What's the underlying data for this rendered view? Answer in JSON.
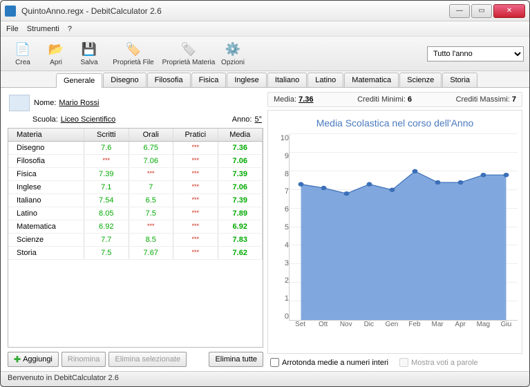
{
  "window": {
    "title": "QuintoAnno.regx - DebitCalculator 2.6"
  },
  "menu": {
    "file": "File",
    "strumenti": "Strumenti",
    "help": "?"
  },
  "toolbar": {
    "crea": "Crea",
    "apri": "Apri",
    "salva": "Salva",
    "prop_file": "Proprietà File",
    "prop_materia": "Proprietà Materia",
    "opzioni": "Opzioni"
  },
  "period": {
    "selected": "Tutto l'anno"
  },
  "tabs": [
    "Generale",
    "Disegno",
    "Filosofia",
    "Fisica",
    "Inglese",
    "Italiano",
    "Latino",
    "Matematica",
    "Scienze",
    "Storia"
  ],
  "student": {
    "nome_label": "Nome:",
    "nome": "Mario Rossi",
    "scuola_label": "Scuola:",
    "scuola": "Liceo Scientifico",
    "anno_label": "Anno:",
    "anno": "5°"
  },
  "grid": {
    "headers": {
      "materia": "Materia",
      "scritti": "Scritti",
      "orali": "Orali",
      "pratici": "Pratici",
      "media": "Media"
    },
    "rows": [
      {
        "materia": "Disegno",
        "scritti": "7.6",
        "orali": "6.75",
        "pratici": "***",
        "media": "7.36",
        "s_cls": "green",
        "o_cls": "green",
        "p_cls": "red"
      },
      {
        "materia": "Filosofia",
        "scritti": "***",
        "orali": "7.06",
        "pratici": "***",
        "media": "7.06",
        "s_cls": "red",
        "o_cls": "green",
        "p_cls": "red"
      },
      {
        "materia": "Fisica",
        "scritti": "7.39",
        "orali": "***",
        "pratici": "***",
        "media": "7.39",
        "s_cls": "green",
        "o_cls": "red",
        "p_cls": "red"
      },
      {
        "materia": "Inglese",
        "scritti": "7.1",
        "orali": "7",
        "pratici": "***",
        "media": "7.06",
        "s_cls": "green",
        "o_cls": "green",
        "p_cls": "red"
      },
      {
        "materia": "Italiano",
        "scritti": "7.54",
        "orali": "6.5",
        "pratici": "***",
        "media": "7.39",
        "s_cls": "green",
        "o_cls": "green",
        "p_cls": "red"
      },
      {
        "materia": "Latino",
        "scritti": "8.05",
        "orali": "7.5",
        "pratici": "***",
        "media": "7.89",
        "s_cls": "green",
        "o_cls": "green",
        "p_cls": "red"
      },
      {
        "materia": "Matematica",
        "scritti": "6.92",
        "orali": "***",
        "pratici": "***",
        "media": "6.92",
        "s_cls": "green",
        "o_cls": "red",
        "p_cls": "red"
      },
      {
        "materia": "Scienze",
        "scritti": "7.7",
        "orali": "8.5",
        "pratici": "***",
        "media": "7.83",
        "s_cls": "green",
        "o_cls": "green",
        "p_cls": "red"
      },
      {
        "materia": "Storia",
        "scritti": "7.5",
        "orali": "7.67",
        "pratici": "***",
        "media": "7.62",
        "s_cls": "green",
        "o_cls": "green",
        "p_cls": "red"
      }
    ]
  },
  "buttons": {
    "aggiungi": "Aggiungi",
    "rinomina": "Rinomina",
    "elimina_sel": "Elimina selezionate",
    "elimina_tutte": "Elimina tutte"
  },
  "stats": {
    "media_label": "Media:",
    "media": "7.36",
    "crediti_min_label": "Crediti Minimi:",
    "crediti_min": "6",
    "crediti_max_label": "Crediti Massimi:",
    "crediti_max": "7"
  },
  "checks": {
    "arrotonda": "Arrotonda medie a numeri interi",
    "parole": "Mostra voti a parole"
  },
  "status": "Benvenuto in DebitCalculator 2.6",
  "chart_data": {
    "type": "area",
    "title": "Media Scolastica nel corso dell'Anno",
    "categories": [
      "Set",
      "Ott",
      "Nov",
      "Dic",
      "Gen",
      "Feb",
      "Mar",
      "Apr",
      "Mag",
      "Giu"
    ],
    "values": [
      7.3,
      7.1,
      6.8,
      7.3,
      7.0,
      8.0,
      7.4,
      7.4,
      7.8,
      7.8
    ],
    "ylim": [
      0,
      10
    ],
    "ylabel": "",
    "xlabel": ""
  },
  "colors": {
    "chart_fill": "#6b99d8",
    "chart_stroke": "#3b6fb8"
  }
}
